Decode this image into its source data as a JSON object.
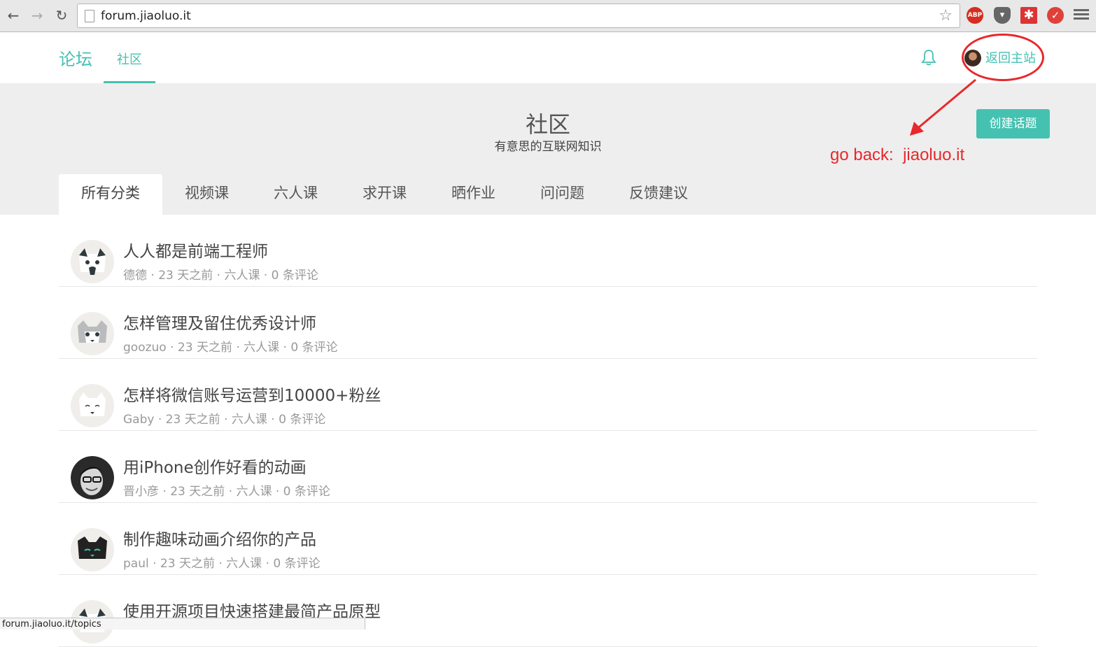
{
  "browser": {
    "url": "forum.jiaoluo.it",
    "status_url": "forum.jiaoluo.it/topics",
    "ext_abp_label": "ABP",
    "ext_pocket_label": "▾",
    "ext_asterisk_label": "✱",
    "ext_check_label": "✓"
  },
  "header": {
    "logo": "论坛",
    "nav_active": "社区",
    "back_link": "返回主站"
  },
  "hero": {
    "title": "社区",
    "subtitle": "有意思的互联网知识",
    "create_button": "创建话题"
  },
  "categories": [
    {
      "label": "所有分类",
      "active": true
    },
    {
      "label": "视频课"
    },
    {
      "label": "六人课"
    },
    {
      "label": "求开课"
    },
    {
      "label": "晒作业"
    },
    {
      "label": "问问题"
    },
    {
      "label": "反馈建议"
    }
  ],
  "topics": [
    {
      "title": "人人都是前端工程师",
      "meta": "德德 · 23 天之前 · 六人课 · 0 条评论",
      "avatar": "cat-siamese"
    },
    {
      "title": "怎样管理及留住优秀设计师",
      "meta": "goozuo · 23 天之前 · 六人课 · 0 条评论",
      "avatar": "cat-grey"
    },
    {
      "title": "怎样将微信账号运营到10000+粉丝",
      "meta": "Gaby · 23 天之前 · 六人课 · 0 条评论",
      "avatar": "cat-white"
    },
    {
      "title": "用iPhone创作好看的动画",
      "meta": "晋小彦 · 23 天之前 · 六人课 · 0 条评论",
      "avatar": "photo-person"
    },
    {
      "title": "制作趣味动画介绍你的产品",
      "meta": "paul · 23 天之前 · 六人课 · 0 条评论",
      "avatar": "cat-black"
    },
    {
      "title": "使用开源项目快速搭建最简产品原型",
      "meta": "",
      "avatar": "cat-siamese"
    }
  ],
  "annotation": {
    "text": "go back:  jiaoluo.it",
    "color": "#e8282c"
  },
  "colors": {
    "accent": "#45c1b1",
    "hero_bg": "#eeeeee"
  }
}
